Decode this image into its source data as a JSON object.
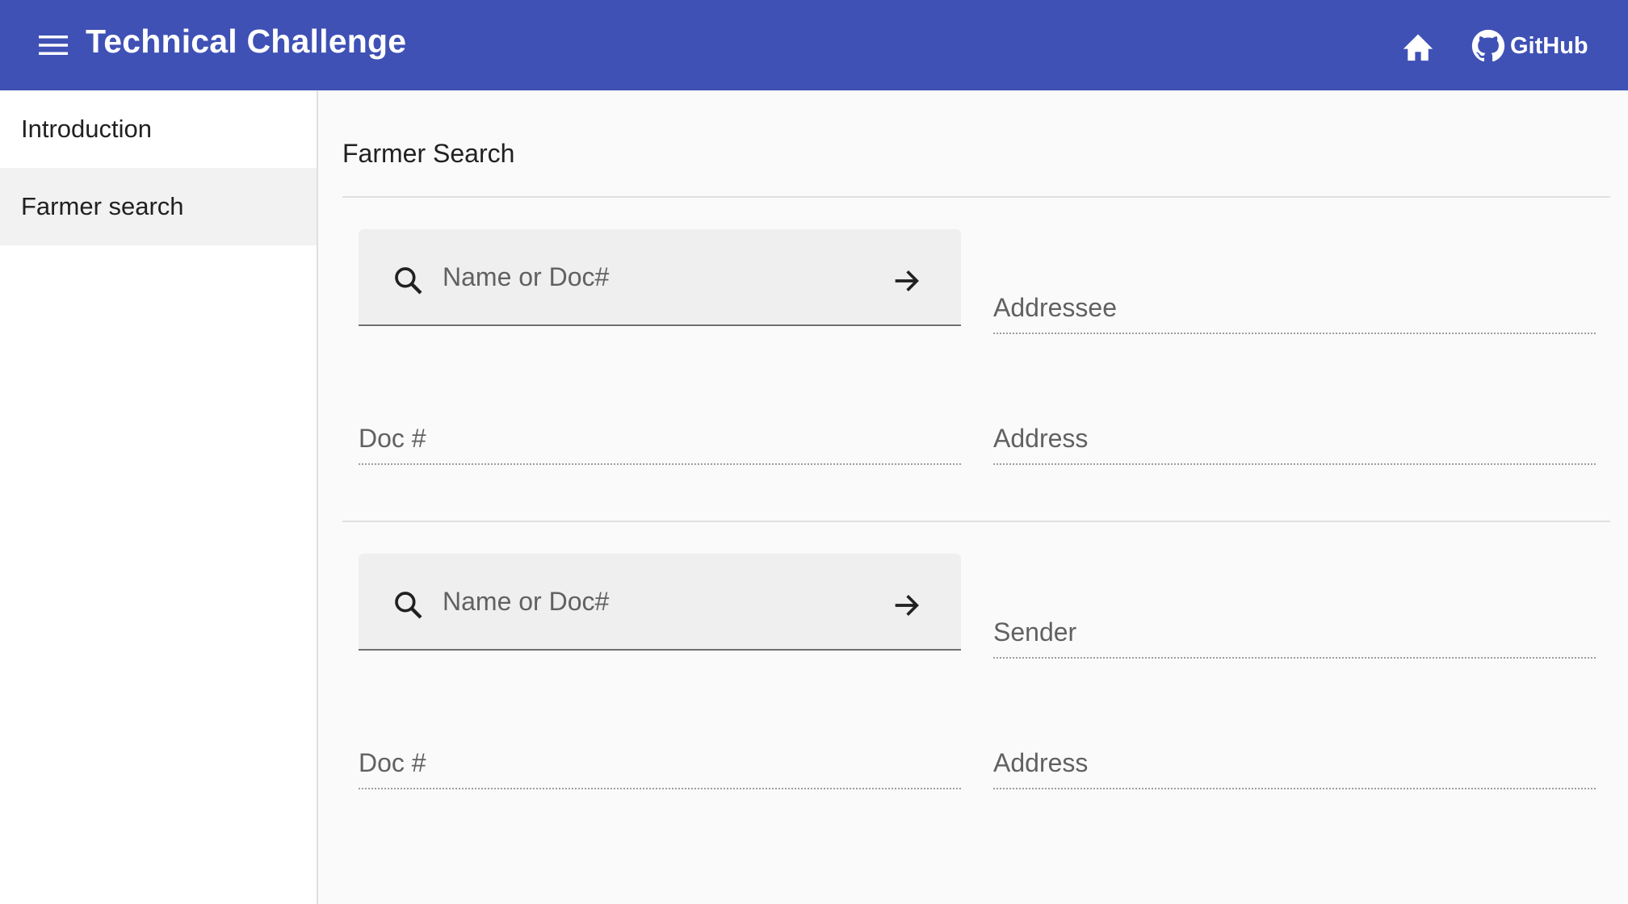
{
  "appbar": {
    "title": "Technical Challenge",
    "menu_icon": "menu-icon",
    "home_icon": "home-icon",
    "github_icon": "github-icon",
    "github_label": "GitHub",
    "color": "#3f51b5"
  },
  "sidebar": {
    "items": [
      {
        "label": "Introduction",
        "selected": false
      },
      {
        "label": "Farmer search",
        "selected": true
      }
    ]
  },
  "main": {
    "heading": "Farmer Search",
    "sections": [
      {
        "search": {
          "placeholder": "Name or Doc#",
          "value": ""
        },
        "party_label": "Addressee",
        "doc_label": "Doc #",
        "address_label": "Address"
      },
      {
        "search": {
          "placeholder": "Name or Doc#",
          "value": ""
        },
        "party_label": "Sender",
        "doc_label": "Doc #",
        "address_label": "Address"
      }
    ]
  }
}
